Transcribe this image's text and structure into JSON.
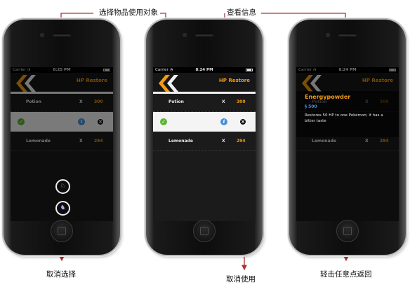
{
  "annotations": {
    "select_target": "选择物品使用对象",
    "view_info": "查看信息",
    "cancel_select": "取消选择",
    "cancel_use": "取消使用",
    "tap_to_return": "轻击任意点返回"
  },
  "status_bar": {
    "carrier": "Carrier",
    "wifi_icon": "wifi-icon",
    "times": [
      "8:25 PM",
      "8:24 PM",
      "8:24 PM"
    ]
  },
  "screen_title": "HP Restore",
  "items": [
    {
      "name": "Potion",
      "x": "X",
      "qty": "300"
    },
    {
      "name": "",
      "x": "",
      "qty": ""
    },
    {
      "name": "Lemonade",
      "x": "X",
      "qty": "294"
    }
  ],
  "info_card": {
    "name": "Energypowder",
    "price": "§ 500",
    "description": "Restores 50 HP to one Pokémon; it has a bitter taste"
  },
  "colors": {
    "accent": "#f39c12",
    "check": "#5cb531",
    "info": "#4a90d9",
    "cancel_red": "#dd3333",
    "arrow": "#b03030"
  },
  "icons": {
    "check": "check-icon",
    "info": "info-icon",
    "cancel": "close-icon",
    "pokemon_1": "pokemon-icon",
    "pokemon_2": "pokemon-icon",
    "cancel_select": "cancel-icon"
  }
}
